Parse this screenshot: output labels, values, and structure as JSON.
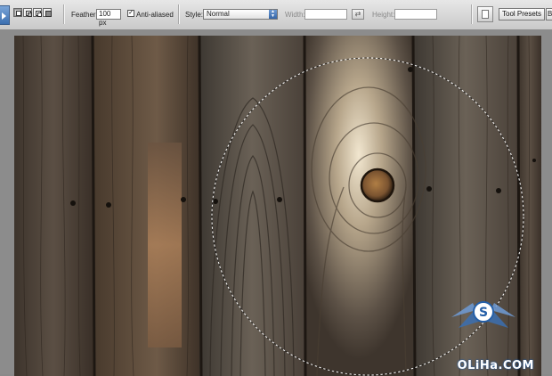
{
  "options_bar": {
    "feather_label": "Feather:",
    "feather_value": "100 px",
    "anti_aliased_label": "Anti-aliased",
    "anti_aliased_checked": true,
    "style_label": "Style:",
    "style_value": "Normal",
    "width_label": "Width:",
    "width_value": "",
    "height_label": "Height:",
    "height_value": "",
    "tool_presets_tab": "Tool Presets",
    "next_tab_partial": "B"
  },
  "canvas": {
    "content": "weathered wood planks with knot",
    "selection": "elliptical marquee"
  },
  "watermark": {
    "text": "OLiHa.COM"
  },
  "icons": {
    "tool_preset": "tool-preset-picker-icon",
    "new_selection": "new-selection-icon",
    "add_selection": "add-to-selection-icon",
    "subtract_selection": "subtract-from-selection-icon",
    "intersect_selection": "intersect-selection-icon",
    "swap": "swap-width-height-icon",
    "document": "document-icon",
    "watermark_logo": "winged-s-logo-icon"
  },
  "colors": {
    "toolbar_bg": "#d6d6d6",
    "accent_blue": "#3b6fb0",
    "wood_dark": "#3a3028",
    "wood_light": "#e8dcc4"
  }
}
